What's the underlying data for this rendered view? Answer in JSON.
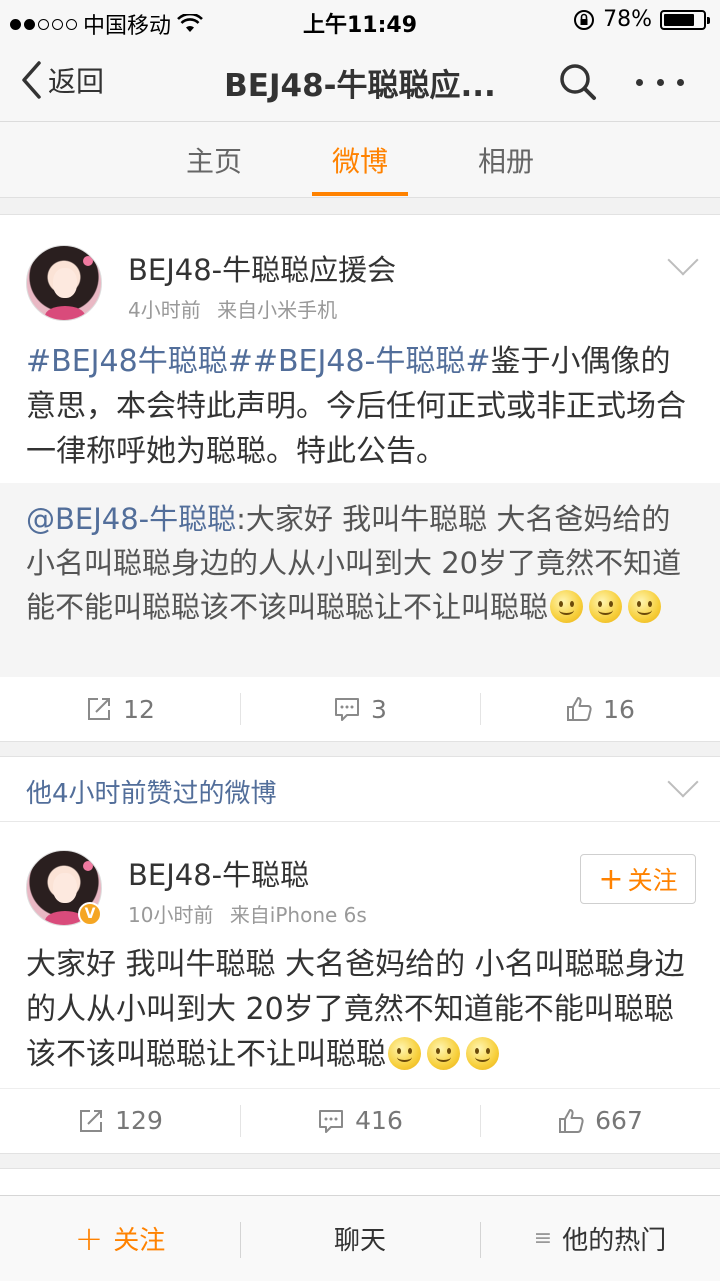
{
  "status_bar": {
    "carrier": "中国移动",
    "time": "上午11:49",
    "battery": "78%",
    "battery_level": 0.78
  },
  "nav": {
    "back_label": "返回",
    "title": "BEJ48-牛聪聪应...",
    "search_icon": "search-icon",
    "more_icon": "more-icon"
  },
  "tabs": [
    {
      "label": "主页",
      "active": false
    },
    {
      "label": "微博",
      "active": true
    },
    {
      "label": "相册",
      "active": false
    }
  ],
  "post1": {
    "user_name": "BEJ48-牛聪聪应援会",
    "time": "4小时前",
    "source": "来自小米手机",
    "hashtag1": "#BEJ48牛聪聪#",
    "hashtag2": "#BEJ48-牛聪聪#",
    "text": "鉴于小偶像的意思，本会特此声明。今后任何正式或非正式场合一律称呼她为聪聪。特此公告。",
    "repost": {
      "mention": "@BEJ48-牛聪聪",
      "text": ":大家好 我叫牛聪聪 大名爸妈给的 小名叫聪聪身边的人从小叫到大 20岁了竟然不知道能不能叫聪聪该不该叫聪聪让不让叫聪聪"
    },
    "actions": {
      "repost": "12",
      "comment": "3",
      "like": "16"
    }
  },
  "section": {
    "title": "他4小时前赞过的微博"
  },
  "post2": {
    "user_name": "BEJ48-牛聪聪",
    "time": "10小时前",
    "source": "来自iPhone 6s",
    "follow_label": "关注",
    "text": "大家好 我叫牛聪聪 大名爸妈给的 小名叫聪聪身边的人从小叫到大 20岁了竟然不知道能不能叫聪聪该不该叫聪聪让不让叫聪聪",
    "actions": {
      "repost": "129",
      "comment": "416",
      "like": "667"
    }
  },
  "bottom_bar": {
    "follow": "关注",
    "chat": "聊天",
    "hot": "他的热门"
  },
  "colors": {
    "accent": "#ff8200",
    "link": "#526e9a"
  }
}
